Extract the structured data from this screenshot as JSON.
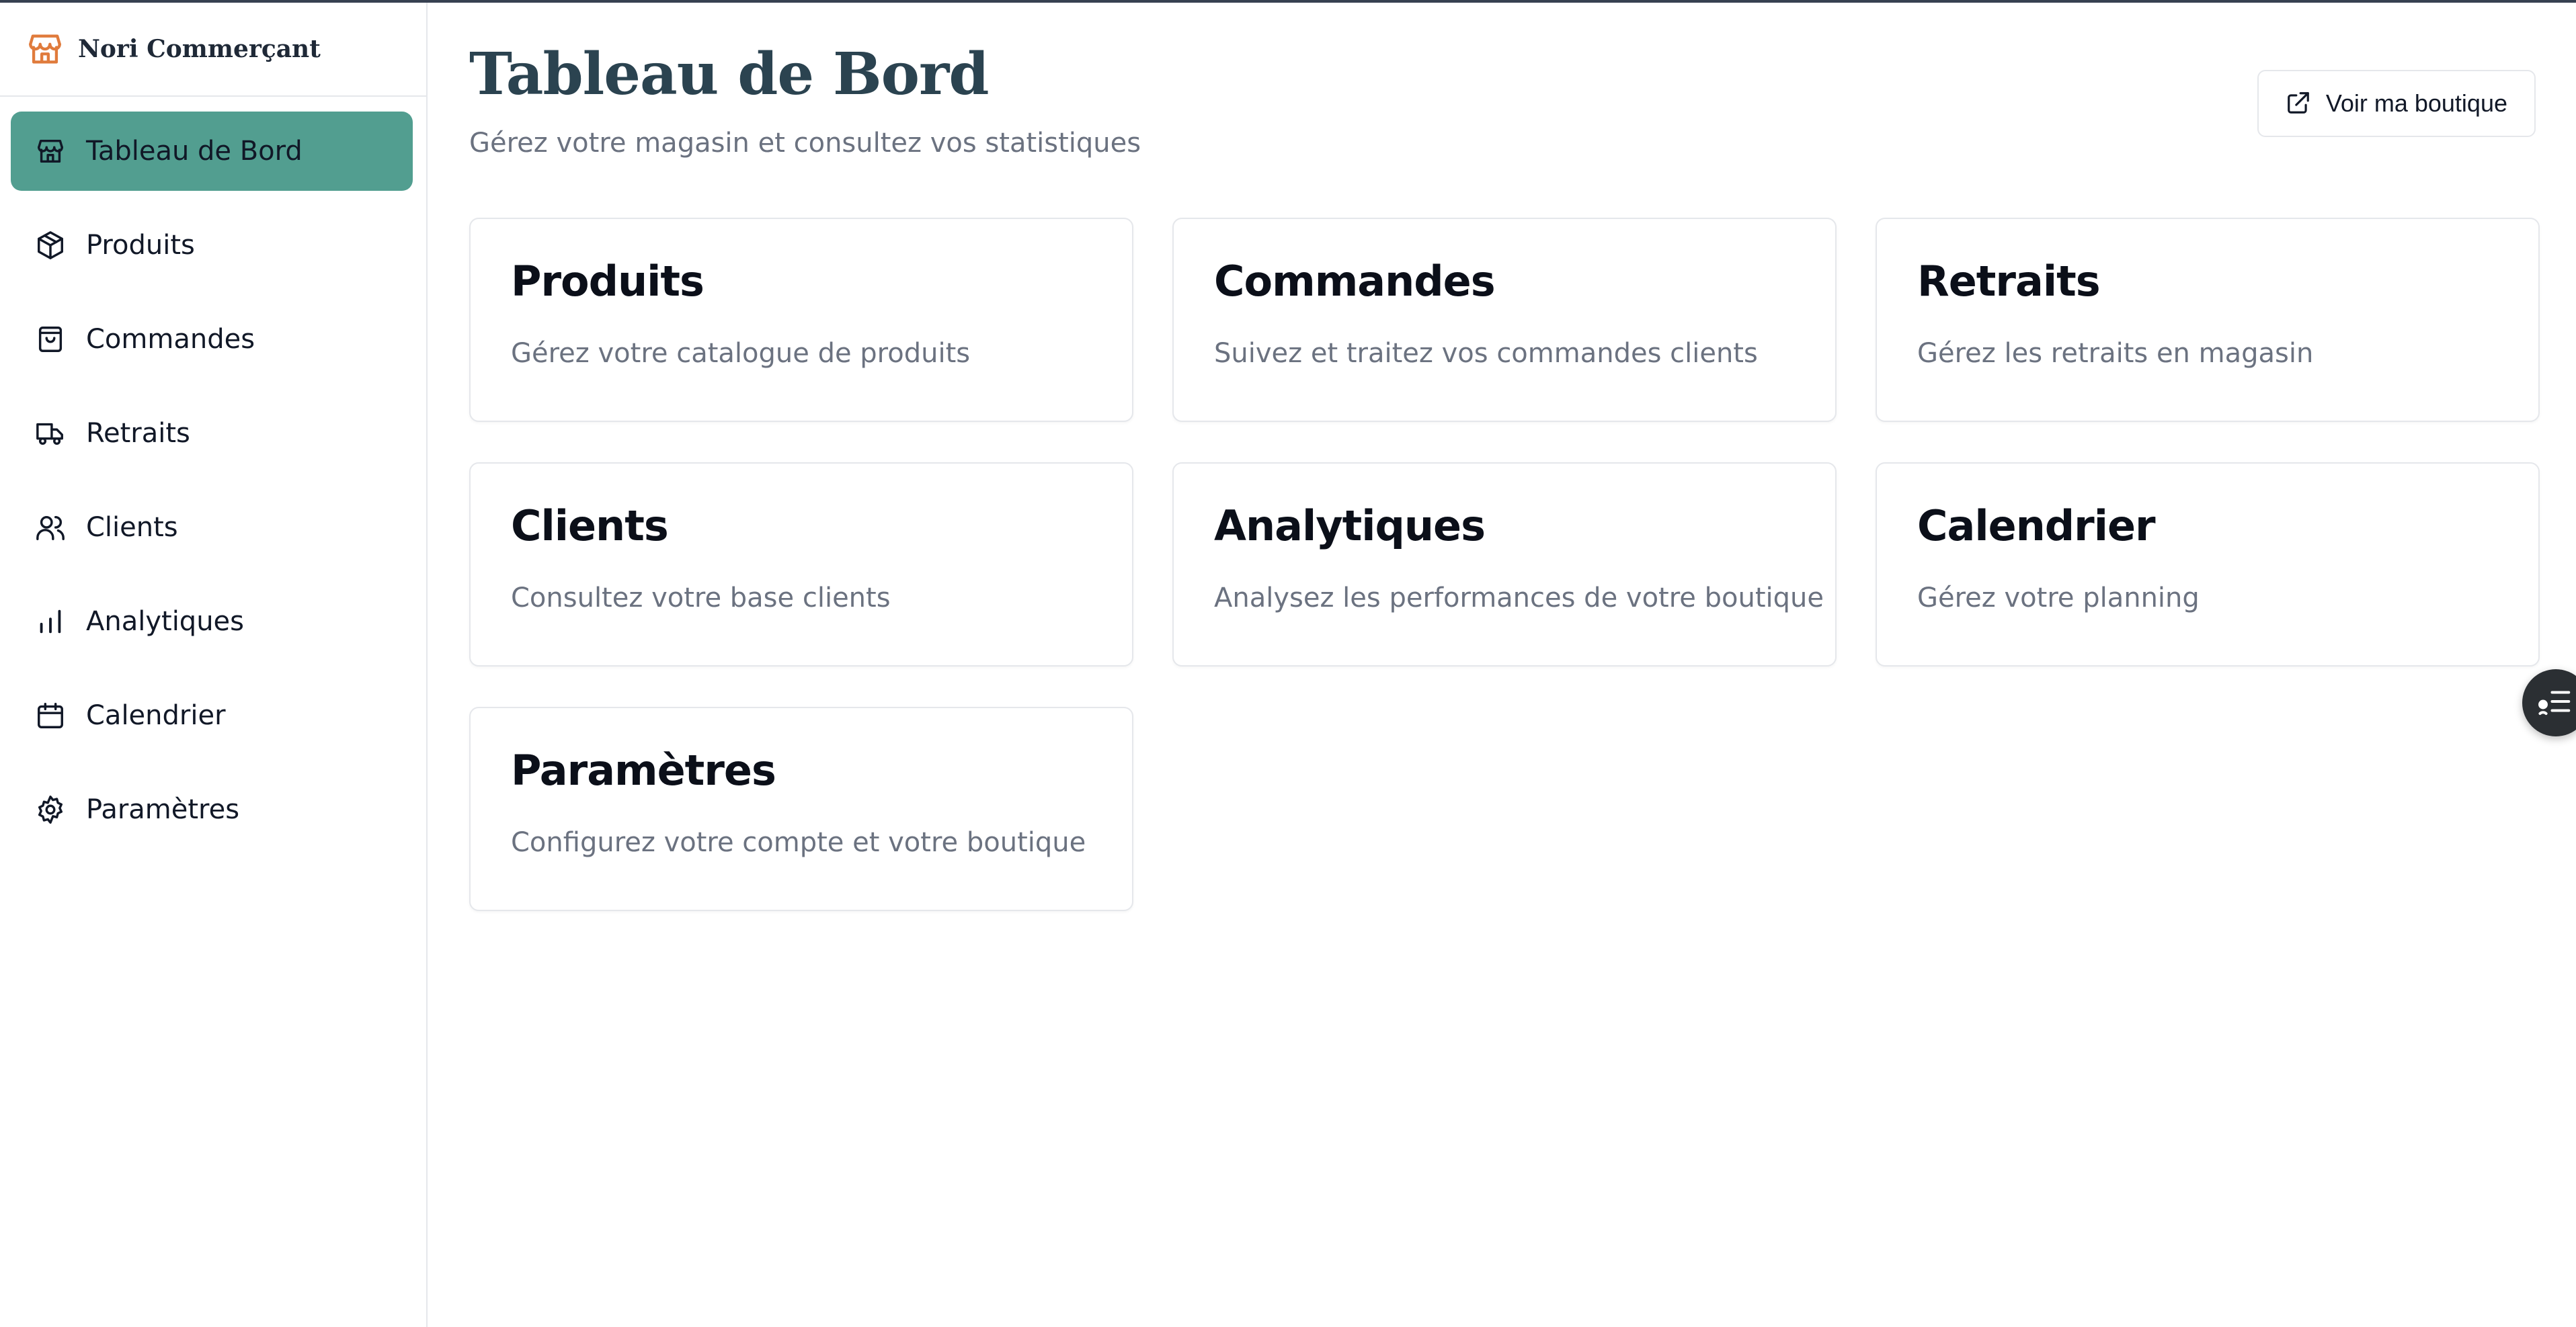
{
  "brand": {
    "name": "Nori Commerçant",
    "icon": "store-icon",
    "accent_color": "#e07b3c"
  },
  "sidebar": {
    "active_color": "#529e90",
    "items": [
      {
        "label": "Tableau de Bord",
        "icon": "store-icon",
        "active": true
      },
      {
        "label": "Produits",
        "icon": "package-icon",
        "active": false
      },
      {
        "label": "Commandes",
        "icon": "shopping-bag-icon",
        "active": false
      },
      {
        "label": "Retraits",
        "icon": "truck-icon",
        "active": false
      },
      {
        "label": "Clients",
        "icon": "users-icon",
        "active": false
      },
      {
        "label": "Analytiques",
        "icon": "bar-chart-icon",
        "active": false
      },
      {
        "label": "Calendrier",
        "icon": "calendar-icon",
        "active": false
      },
      {
        "label": "Paramètres",
        "icon": "settings-icon",
        "active": false
      }
    ]
  },
  "header": {
    "title": "Tableau de Bord",
    "subtitle": "Gérez votre magasin et consultez vos statistiques",
    "shop_button_label": "Voir ma boutique",
    "shop_button_icon": "external-link-icon"
  },
  "cards": [
    {
      "title": "Produits",
      "description": "Gérez votre catalogue de produits"
    },
    {
      "title": "Commandes",
      "description": "Suivez et traitez vos commandes clients"
    },
    {
      "title": "Retraits",
      "description": "Gérez les retraits en magasin"
    },
    {
      "title": "Clients",
      "description": "Consultez votre base clients"
    },
    {
      "title": "Analytiques",
      "description": "Analysez les performances de votre boutique"
    },
    {
      "title": "Calendrier",
      "description": "Gérez votre planning"
    },
    {
      "title": "Paramètres",
      "description": "Configurez votre compte et votre boutique"
    }
  ],
  "floating_button": {
    "icon": "task-list-icon"
  }
}
